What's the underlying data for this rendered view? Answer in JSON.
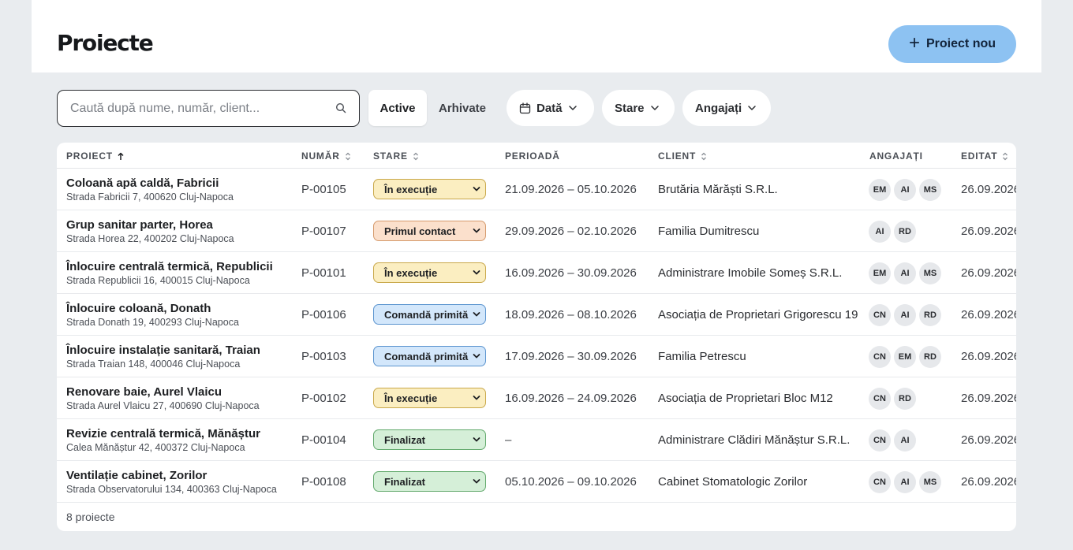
{
  "header": {
    "title": "Proiecte",
    "new_button": "Proiect nou"
  },
  "toolbar": {
    "search_placeholder": "Caută după nume, număr, client...",
    "tabs": [
      "Active",
      "Arhivate"
    ],
    "filters": {
      "date": "Dată",
      "status": "Stare",
      "employees": "Angajați"
    }
  },
  "table": {
    "columns": {
      "project": "PROIECT",
      "number": "NUMĂR",
      "status": "STARE",
      "period": "PERIOADĂ",
      "client": "CLIENT",
      "employees": "ANGAJAȚI",
      "edited": "EDITAT"
    },
    "rows": [
      {
        "name": "Coloană apă caldă, Fabricii",
        "address": "Strada Fabricii 7, 400620 Cluj-Napoca",
        "number": "P-00105",
        "status": "În execuție",
        "period": "21.09.2026 – 05.10.2026",
        "client": "Brutăria Mărăști S.R.L.",
        "employees": [
          "EM",
          "AI",
          "MS"
        ],
        "edited": "26.09.2026"
      },
      {
        "name": "Grup sanitar parter, Horea",
        "address": "Strada Horea 22, 400202 Cluj-Napoca",
        "number": "P-00107",
        "status": "Primul contact",
        "period": "29.09.2026 – 02.10.2026",
        "client": "Familia Dumitrescu",
        "employees": [
          "AI",
          "RD"
        ],
        "edited": "26.09.2026"
      },
      {
        "name": "Înlocuire centrală termică, Republicii",
        "address": "Strada Republicii 16, 400015 Cluj-Napoca",
        "number": "P-00101",
        "status": "În execuție",
        "period": "16.09.2026 – 30.09.2026",
        "client": "Administrare Imobile Someș S.R.L.",
        "employees": [
          "EM",
          "AI",
          "MS"
        ],
        "edited": "26.09.2026"
      },
      {
        "name": "Înlocuire coloană, Donath",
        "address": "Strada Donath 19, 400293 Cluj-Napoca",
        "number": "P-00106",
        "status": "Comandă primită",
        "period": "18.09.2026 – 08.10.2026",
        "client": "Asociația de Proprietari Grigorescu 19",
        "employees": [
          "CN",
          "AI",
          "RD"
        ],
        "edited": "26.09.2026"
      },
      {
        "name": "Înlocuire instalație sanitară, Traian",
        "address": "Strada Traian 148, 400046 Cluj-Napoca",
        "number": "P-00103",
        "status": "Comandă primită",
        "period": "17.09.2026 – 30.09.2026",
        "client": "Familia Petrescu",
        "employees": [
          "CN",
          "EM",
          "RD"
        ],
        "edited": "26.09.2026"
      },
      {
        "name": "Renovare baie, Aurel Vlaicu",
        "address": "Strada Aurel Vlaicu 27, 400690 Cluj-Napoca",
        "number": "P-00102",
        "status": "În execuție",
        "period": "16.09.2026 – 24.09.2026",
        "client": "Asociația de Proprietari Bloc M12",
        "employees": [
          "CN",
          "RD"
        ],
        "edited": "26.09.2026"
      },
      {
        "name": "Revizie centrală termică, Mănăștur",
        "address": "Calea Mănăștur 42, 400372 Cluj-Napoca",
        "number": "P-00104",
        "status": "Finalizat",
        "period": "–",
        "client": "Administrare Clădiri Mănăștur S.R.L.",
        "employees": [
          "CN",
          "AI"
        ],
        "edited": "26.09.2026"
      },
      {
        "name": "Ventilație cabinet, Zorilor",
        "address": "Strada Observatorului 134, 400363 Cluj-Napoca",
        "number": "P-00108",
        "status": "Finalizat",
        "period": "05.10.2026 – 09.10.2026",
        "client": "Cabinet Stomatologic Zorilor",
        "employees": [
          "CN",
          "AI",
          "MS"
        ],
        "edited": "26.09.2026"
      }
    ],
    "footer": "8 proiecte"
  },
  "status_colors": {
    "În execuție": {
      "bg": "#fbeec1",
      "border": "#c9a84a"
    },
    "Primul contact": {
      "bg": "#fbe0cc",
      "border": "#d59a6c"
    },
    "Comandă primită": {
      "bg": "#d3e7fb",
      "border": "#5b94cf"
    },
    "Finalizat": {
      "bg": "#d5efd8",
      "border": "#62a96c"
    }
  },
  "icons": {
    "new": "plus-icon",
    "search": "search-icon",
    "date": "calendar-icon",
    "dropdown": "chevron-down-icon",
    "sort_active": "arrow-up-icon",
    "sort": "sort-icon"
  }
}
